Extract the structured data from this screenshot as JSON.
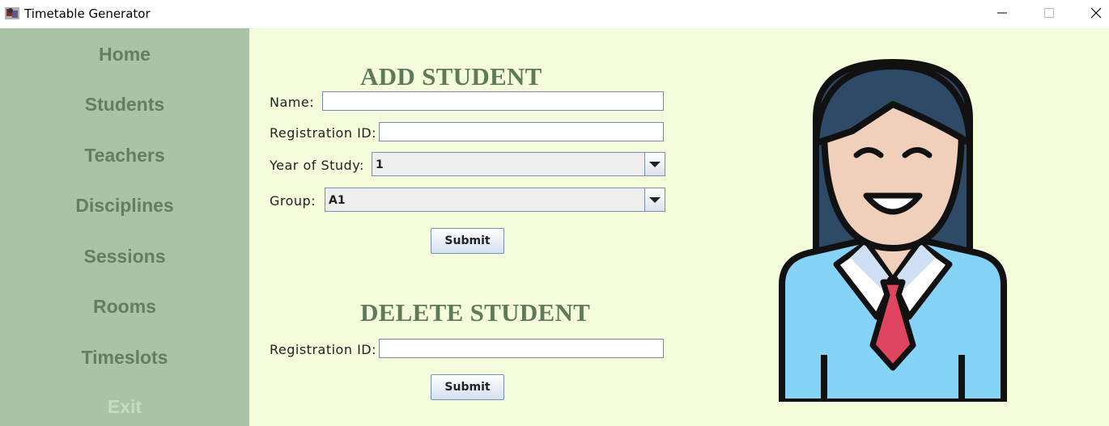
{
  "window": {
    "title": "Timetable Generator",
    "app_icon": "java-app-icon",
    "controls": [
      "minimize-icon",
      "maximize-icon",
      "close-icon"
    ]
  },
  "sidebar": {
    "items": [
      {
        "label": "Home"
      },
      {
        "label": "Students"
      },
      {
        "label": "Teachers"
      },
      {
        "label": "Disciplines"
      },
      {
        "label": "Sessions"
      },
      {
        "label": "Rooms"
      },
      {
        "label": "Timeslots"
      },
      {
        "label": "Exit"
      }
    ]
  },
  "add_student": {
    "title": "ADD STUDENT",
    "name_label": "Name:",
    "name_value": "",
    "reg_label": "Registration ID:",
    "reg_value": "",
    "year_label": "Year of Study:",
    "year_value": "1",
    "group_label": "Group:",
    "group_value": "A1",
    "submit_label": "Submit"
  },
  "delete_student": {
    "title": "DELETE STUDENT",
    "reg_label": "Registration ID:",
    "reg_value": "",
    "submit_label": "Submit"
  },
  "colors": {
    "sidebar_bg": "#a9c4a5",
    "sidebar_text": "#637e5e",
    "main_bg": "#f4fcdc",
    "title_text": "#5f7a5a"
  },
  "illustration": "student-girl-avatar"
}
